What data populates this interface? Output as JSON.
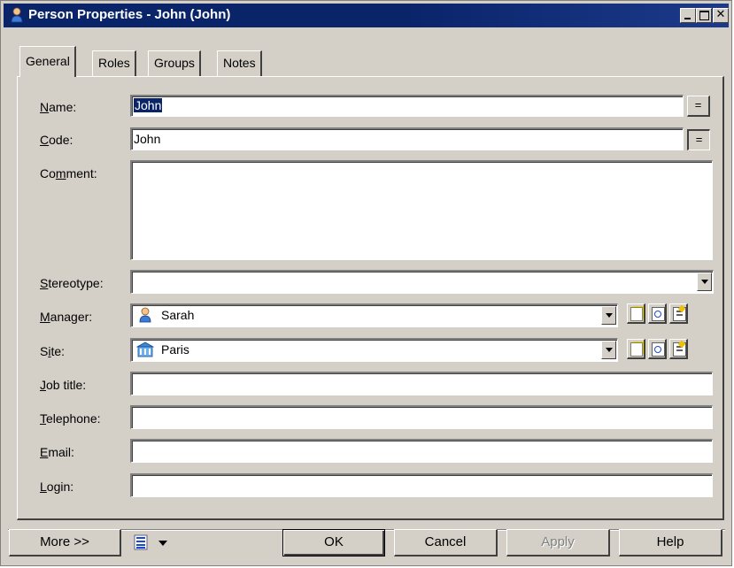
{
  "window": {
    "title": "Person Properties - John (John)"
  },
  "tabs": [
    {
      "label": "General",
      "active": true
    },
    {
      "label": "Roles",
      "active": false
    },
    {
      "label": "Groups",
      "active": false
    },
    {
      "label": "Notes",
      "active": false
    }
  ],
  "form": {
    "name": {
      "label_hot": "N",
      "label_rest": "ame:",
      "value": "John"
    },
    "code": {
      "label_hot": "C",
      "label_rest": "ode:",
      "value": "John"
    },
    "comment": {
      "label_pre": "Co",
      "label_hot": "m",
      "label_rest": "ment:",
      "value": ""
    },
    "stereotype": {
      "label_hot": "S",
      "label_rest": "tereotype:",
      "value": ""
    },
    "manager": {
      "label_hot": "M",
      "label_rest": "anager:",
      "value": "Sarah",
      "icon": "person-icon"
    },
    "site": {
      "label_pre": "S",
      "label_hot": "i",
      "label_rest": "te:",
      "value": "Paris",
      "icon": "building-icon"
    },
    "job_title": {
      "label_hot": "J",
      "label_rest": "ob title:",
      "value": ""
    },
    "telephone": {
      "label_hot": "T",
      "label_rest": "elephone:",
      "value": ""
    },
    "email": {
      "label_hot": "E",
      "label_rest": "mail:",
      "value": ""
    },
    "login": {
      "label_hot": "L",
      "label_rest": "ogin:",
      "value": ""
    },
    "eq_label": "="
  },
  "footer": {
    "more": "More >>",
    "ok": "OK",
    "cancel": "Cancel",
    "apply": "Apply",
    "help": "Help"
  },
  "colors": {
    "titlebar": "#0a246a",
    "dialog": "#d4d0c8",
    "selection": "#0a246a"
  }
}
